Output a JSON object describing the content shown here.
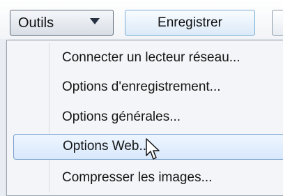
{
  "toolbar": {
    "tools_label": "Outils",
    "dropdown_icon": "chevron-down",
    "save_label": "Enregistrer"
  },
  "menu": {
    "items": [
      {
        "label": "Connecter un lecteur réseau..."
      },
      {
        "label": "Options d'enregistrement..."
      },
      {
        "label": "Options générales..."
      },
      {
        "label": "Options Web..."
      },
      {
        "label": "Compresser les images..."
      }
    ],
    "highlighted_index": 3
  },
  "colors": {
    "background": "#e8edf3",
    "menu_background": "#f4f5f8",
    "menu_border": "#9ca4ae",
    "highlight_fill": "#d8e8fb",
    "highlight_border": "#7da2ce",
    "save_border": "#78aed7"
  },
  "cursor": {
    "icon": "mouse-pointer-icon"
  }
}
